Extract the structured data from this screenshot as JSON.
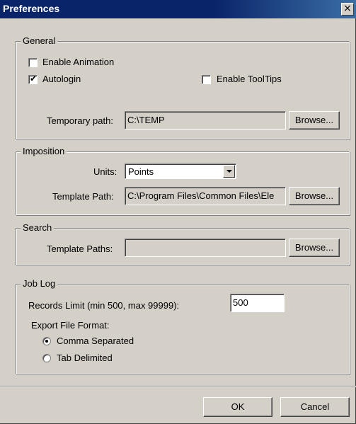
{
  "window": {
    "title": "Preferences",
    "close_glyph": "×"
  },
  "general": {
    "legend": "General",
    "enable_animation": {
      "label": "Enable Animation",
      "checked": false
    },
    "autologin": {
      "label": "Autologin",
      "checked": true
    },
    "enable_tooltips": {
      "label": "Enable ToolTips",
      "checked": false
    },
    "temp_path_label": "Temporary path:",
    "temp_path_value": "C:\\TEMP",
    "browse_label": "Browse..."
  },
  "imposition": {
    "legend": "Imposition",
    "units_label": "Units:",
    "units_value": "Points",
    "template_path_label": "Template Path:",
    "template_path_value": "C:\\Program Files\\Common Files\\Ele",
    "browse_label": "Browse..."
  },
  "search": {
    "legend": "Search",
    "template_paths_label": "Template Paths:",
    "template_paths_value": "",
    "browse_label": "Browse..."
  },
  "job_log": {
    "legend": "Job Log",
    "records_limit_label": "Records Limit (min 500, max 99999):",
    "records_limit_value": "500",
    "export_format_label": "Export File Format:",
    "options": [
      {
        "label": "Comma Separated",
        "selected": true
      },
      {
        "label": "Tab Delimited",
        "selected": false
      }
    ]
  },
  "footer": {
    "ok_label": "OK",
    "cancel_label": "Cancel"
  },
  "colors": {
    "title_bar": "#0a246a",
    "face": "#d4d0c8"
  }
}
